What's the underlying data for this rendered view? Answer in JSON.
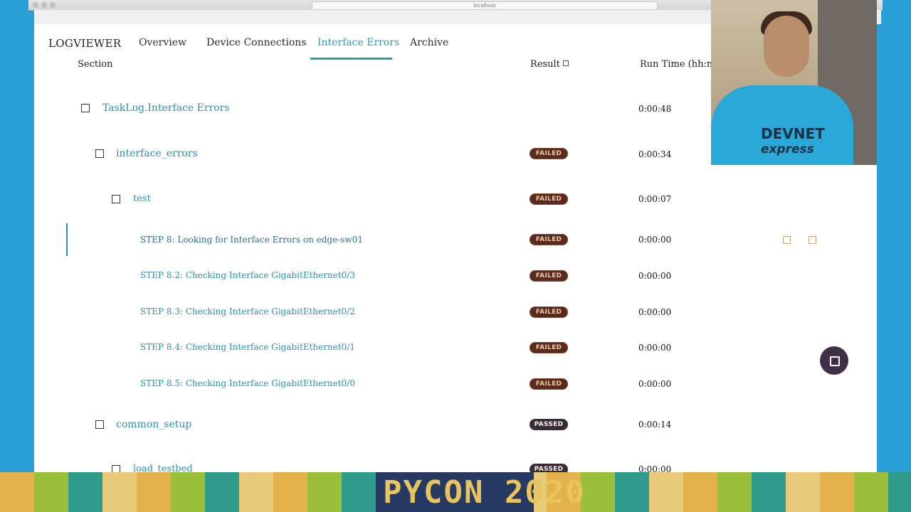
{
  "browser": {
    "url": "localhost"
  },
  "nav": {
    "brand": "LOGVIEWER",
    "links": [
      "Overview",
      "Device Connections",
      "Interface Errors",
      "Archive"
    ],
    "active": "Interface Errors"
  },
  "columns": {
    "section": "Section",
    "result": "Result",
    "runtime": "Run Time (hh:mn"
  },
  "rows": [
    {
      "label": "TaskLog.Interface Errors",
      "result": "",
      "time": "0:00:48"
    },
    {
      "label": "interface_errors",
      "result": "FAILED",
      "time": "0:00:34"
    },
    {
      "label": "test",
      "result": "FAILED",
      "time": "0:00:07"
    },
    {
      "label": "STEP 8: Looking for Interface Errors on edge-sw01",
      "result": "FAILED",
      "time": "0:00:00"
    },
    {
      "label": "STEP 8.2: Checking Interface GigabitEthernet0/3",
      "result": "FAILED",
      "time": "0:00:00"
    },
    {
      "label": "STEP 8.3: Checking Interface GigabitEthernet0/2",
      "result": "FAILED",
      "time": "0:00:00"
    },
    {
      "label": "STEP 8.4: Checking Interface GigabitEthernet0/1",
      "result": "FAILED",
      "time": "0:00:00"
    },
    {
      "label": "STEP 8.5: Checking Interface GigabitEthernet0/0",
      "result": "FAILED",
      "time": "0:00:00"
    },
    {
      "label": "common_setup",
      "result": "PASSED",
      "time": "0:00:14"
    },
    {
      "label": "load_testbed",
      "result": "PASSED",
      "time": "0:00:00"
    }
  ],
  "webcam": {
    "shirt_line1": "DEVNET",
    "shirt_line2": "express"
  },
  "banner": {
    "text": "PYCON 2020"
  },
  "colors": {
    "accent": "#2e9bb5",
    "failed_badge": "#5b2a1e",
    "passed_badge": "#3a2a35",
    "background": "#2a9fd6"
  }
}
